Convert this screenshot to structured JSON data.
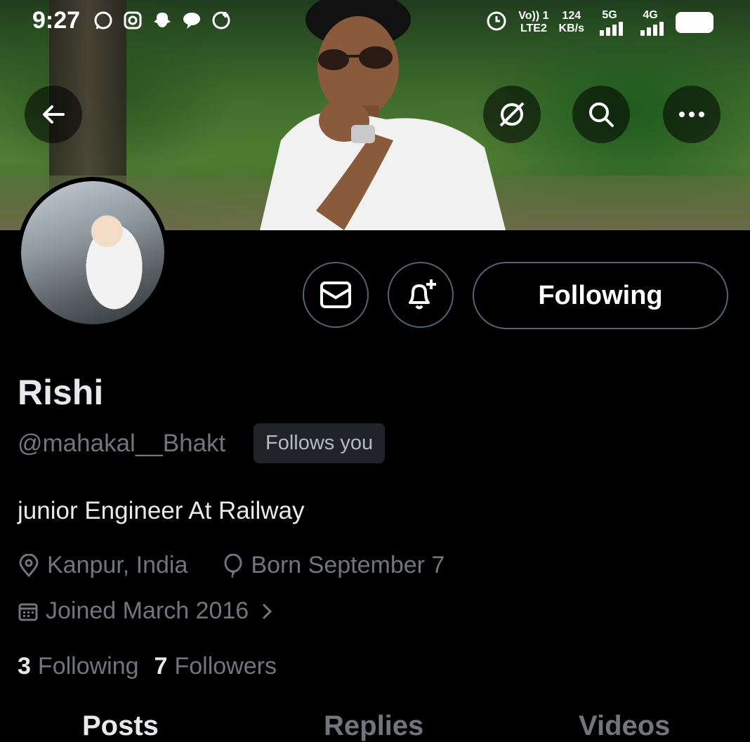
{
  "status_bar": {
    "time": "9:27",
    "network_left_top": "Vo)) 1",
    "network_left_bottom": "LTE2",
    "speed_value": "124",
    "speed_unit": "KB/s",
    "sim1_label": "5G",
    "sim2_label": "4G"
  },
  "profile": {
    "name": "Rishi",
    "handle": "@mahakal__Bhakt",
    "follows_you_badge": "Follows you",
    "bio": "junior Engineer At Railway",
    "location": "Kanpur, India",
    "birthday": "Born September 7",
    "joined": "Joined March 2016",
    "following_count": "3",
    "following_label": "Following",
    "followers_count": "7",
    "followers_label": "Followers"
  },
  "actions": {
    "following_button": "Following"
  },
  "tabs": [
    "Posts",
    "Replies",
    "Videos"
  ],
  "icons": {
    "back": "arrow-left-icon",
    "grok": "grok-icon",
    "search": "search-icon",
    "more": "more-icon",
    "message": "envelope-icon",
    "notify": "bell-plus-icon",
    "location": "location-pin-icon",
    "birthday": "balloon-icon",
    "calendar": "calendar-icon"
  },
  "colors": {
    "background": "#000000",
    "primary_text": "#e7e9ea",
    "secondary_text": "#71767b",
    "border": "#536471",
    "badge_bg": "#202327"
  }
}
